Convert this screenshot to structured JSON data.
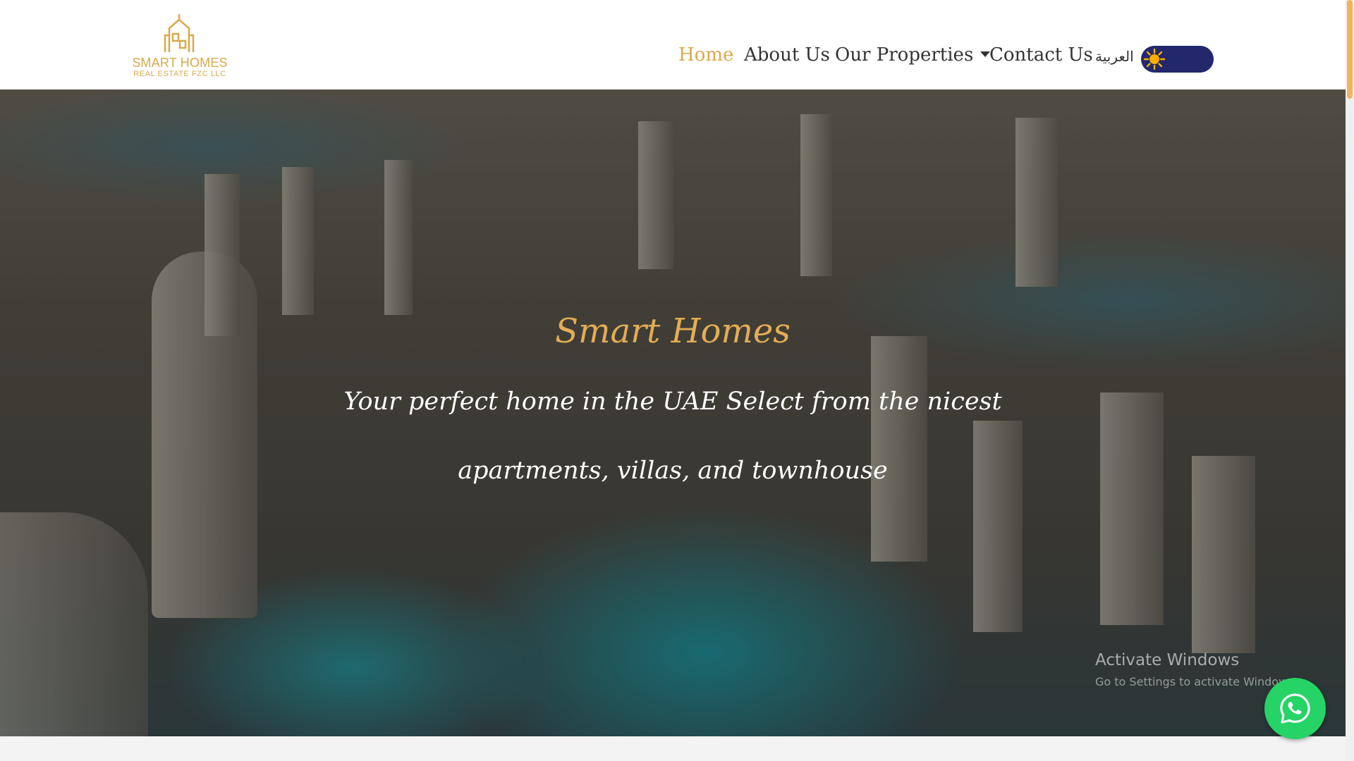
{
  "brand": {
    "name": "SMART HOMES",
    "subtitle": "REAL ESTATE FZC LLC",
    "color": "#d8a94c"
  },
  "nav": {
    "items": [
      {
        "label": "Home",
        "active": true
      },
      {
        "label": "About Us",
        "active": false
      },
      {
        "label": "Our Properties",
        "active": false,
        "dropdown": true
      },
      {
        "label": "Contact Us",
        "active": false
      }
    ],
    "language": "العربية",
    "theme_toggle": {
      "icon": "sun-icon",
      "color": "#22286b"
    }
  },
  "hero": {
    "title": "Smart Homes",
    "line1": "Your perfect home in the UAE Select from the nicest",
    "line2": "apartments, villas, and townhouse"
  },
  "system_watermark": {
    "title": "Activate Windows",
    "subtitle": "Go to Settings to activate Windows."
  },
  "floating_button": {
    "icon": "whatsapp-icon",
    "color": "#25d366"
  }
}
